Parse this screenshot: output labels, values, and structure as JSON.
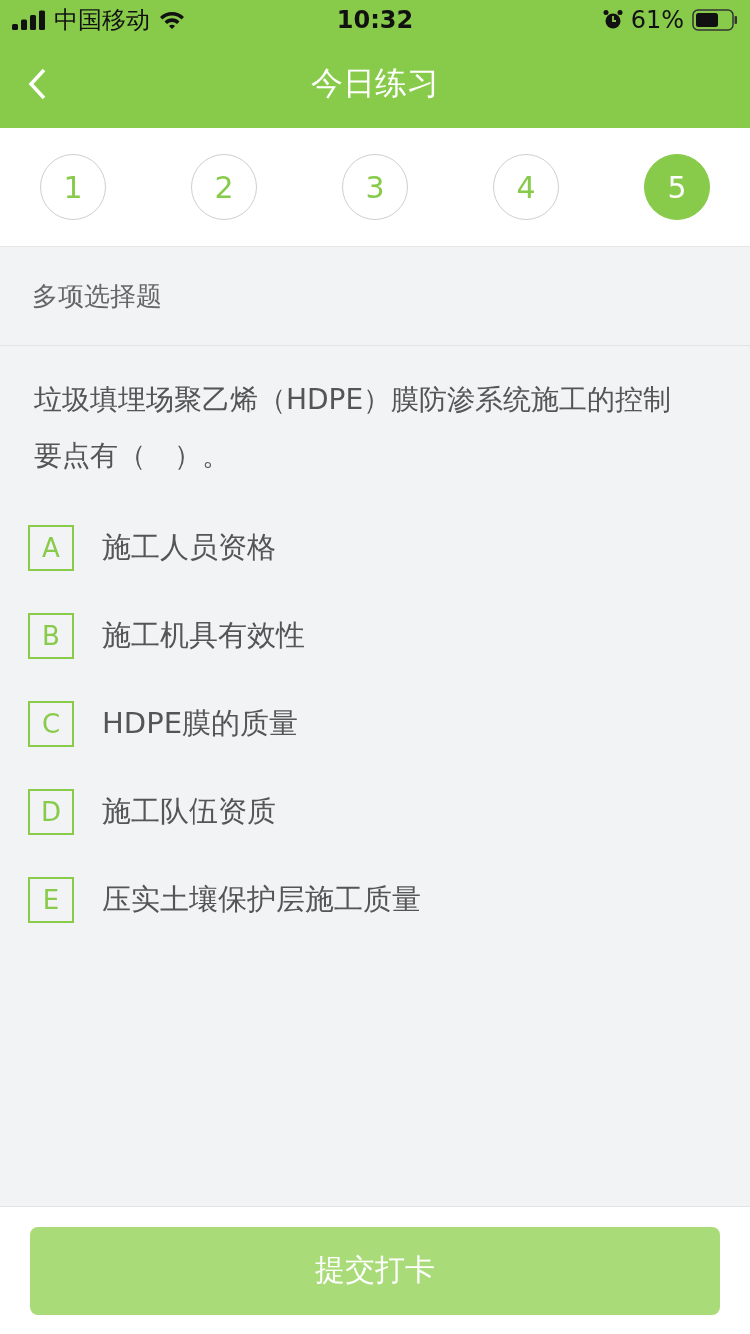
{
  "status_bar": {
    "carrier": "中国移动",
    "time": "10:32",
    "battery": "61%"
  },
  "nav": {
    "title": "今日练习"
  },
  "steps": [
    {
      "label": "1",
      "selected": false
    },
    {
      "label": "2",
      "selected": false
    },
    {
      "label": "3",
      "selected": false
    },
    {
      "label": "4",
      "selected": false
    },
    {
      "label": "5",
      "selected": true
    }
  ],
  "question_type": "多项选择题",
  "question": "垃圾填埋场聚乙烯（HDPE）膜防渗系统施工的控制要点有（　）。",
  "options": [
    {
      "letter": "A",
      "text": "施工人员资格",
      "selected": false
    },
    {
      "letter": "B",
      "text": "施工机具有效性",
      "selected": false
    },
    {
      "letter": "C",
      "text": "HDPE膜的质量",
      "selected": false
    },
    {
      "letter": "D",
      "text": "施工队伍资质",
      "selected": false
    },
    {
      "letter": "E",
      "text": "压实土壤保护层施工质量",
      "selected": false
    }
  ],
  "submit": {
    "label": "提交打卡",
    "disabled": true
  }
}
